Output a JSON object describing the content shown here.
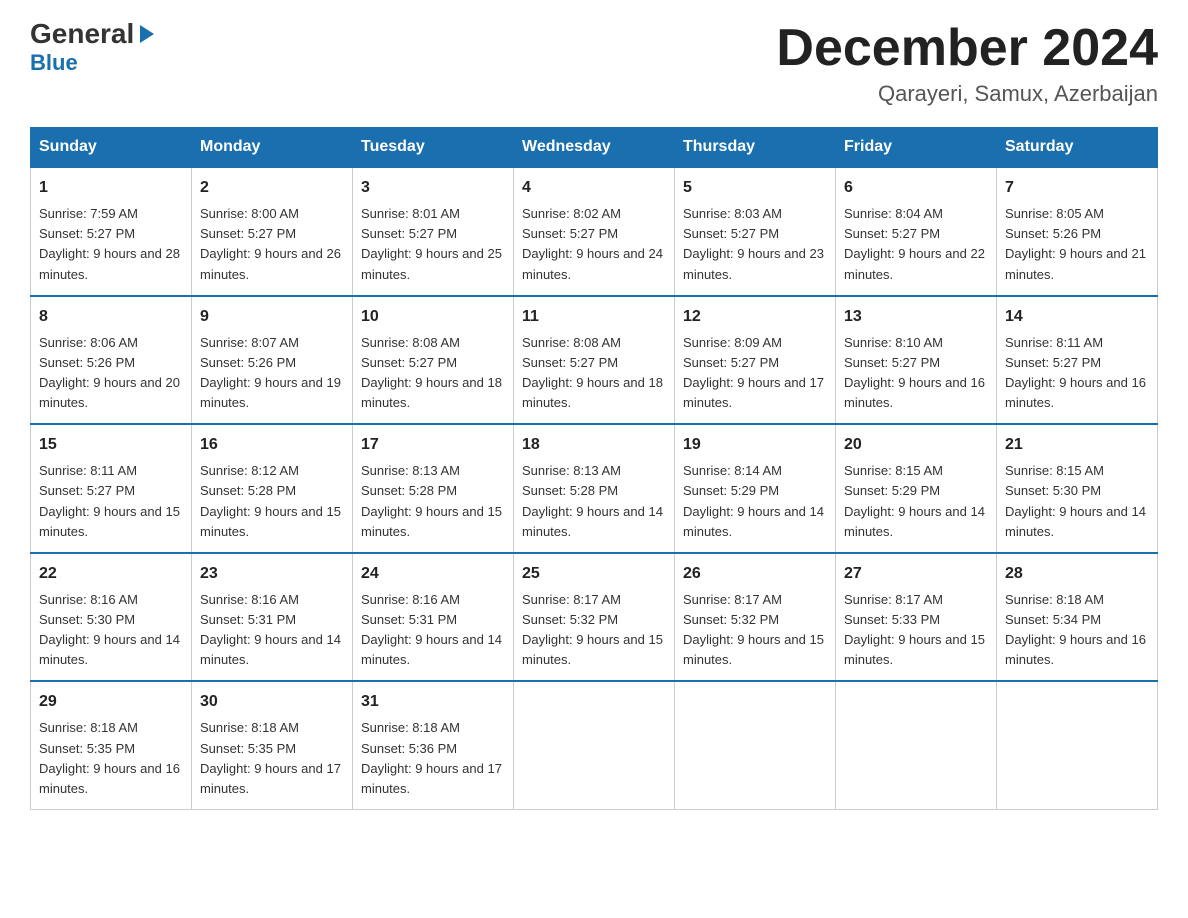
{
  "logo": {
    "line1_black": "General",
    "line1_blue": "Blue",
    "line2": "Blue"
  },
  "header": {
    "month_year": "December 2024",
    "location": "Qarayeri, Samux, Azerbaijan"
  },
  "days_of_week": [
    "Sunday",
    "Monday",
    "Tuesday",
    "Wednesday",
    "Thursday",
    "Friday",
    "Saturday"
  ],
  "weeks": [
    [
      {
        "day": "1",
        "sunrise": "7:59 AM",
        "sunset": "5:27 PM",
        "daylight": "9 hours and 28 minutes."
      },
      {
        "day": "2",
        "sunrise": "8:00 AM",
        "sunset": "5:27 PM",
        "daylight": "9 hours and 26 minutes."
      },
      {
        "day": "3",
        "sunrise": "8:01 AM",
        "sunset": "5:27 PM",
        "daylight": "9 hours and 25 minutes."
      },
      {
        "day": "4",
        "sunrise": "8:02 AM",
        "sunset": "5:27 PM",
        "daylight": "9 hours and 24 minutes."
      },
      {
        "day": "5",
        "sunrise": "8:03 AM",
        "sunset": "5:27 PM",
        "daylight": "9 hours and 23 minutes."
      },
      {
        "day": "6",
        "sunrise": "8:04 AM",
        "sunset": "5:27 PM",
        "daylight": "9 hours and 22 minutes."
      },
      {
        "day": "7",
        "sunrise": "8:05 AM",
        "sunset": "5:26 PM",
        "daylight": "9 hours and 21 minutes."
      }
    ],
    [
      {
        "day": "8",
        "sunrise": "8:06 AM",
        "sunset": "5:26 PM",
        "daylight": "9 hours and 20 minutes."
      },
      {
        "day": "9",
        "sunrise": "8:07 AM",
        "sunset": "5:26 PM",
        "daylight": "9 hours and 19 minutes."
      },
      {
        "day": "10",
        "sunrise": "8:08 AM",
        "sunset": "5:27 PM",
        "daylight": "9 hours and 18 minutes."
      },
      {
        "day": "11",
        "sunrise": "8:08 AM",
        "sunset": "5:27 PM",
        "daylight": "9 hours and 18 minutes."
      },
      {
        "day": "12",
        "sunrise": "8:09 AM",
        "sunset": "5:27 PM",
        "daylight": "9 hours and 17 minutes."
      },
      {
        "day": "13",
        "sunrise": "8:10 AM",
        "sunset": "5:27 PM",
        "daylight": "9 hours and 16 minutes."
      },
      {
        "day": "14",
        "sunrise": "8:11 AM",
        "sunset": "5:27 PM",
        "daylight": "9 hours and 16 minutes."
      }
    ],
    [
      {
        "day": "15",
        "sunrise": "8:11 AM",
        "sunset": "5:27 PM",
        "daylight": "9 hours and 15 minutes."
      },
      {
        "day": "16",
        "sunrise": "8:12 AM",
        "sunset": "5:28 PM",
        "daylight": "9 hours and 15 minutes."
      },
      {
        "day": "17",
        "sunrise": "8:13 AM",
        "sunset": "5:28 PM",
        "daylight": "9 hours and 15 minutes."
      },
      {
        "day": "18",
        "sunrise": "8:13 AM",
        "sunset": "5:28 PM",
        "daylight": "9 hours and 14 minutes."
      },
      {
        "day": "19",
        "sunrise": "8:14 AM",
        "sunset": "5:29 PM",
        "daylight": "9 hours and 14 minutes."
      },
      {
        "day": "20",
        "sunrise": "8:15 AM",
        "sunset": "5:29 PM",
        "daylight": "9 hours and 14 minutes."
      },
      {
        "day": "21",
        "sunrise": "8:15 AM",
        "sunset": "5:30 PM",
        "daylight": "9 hours and 14 minutes."
      }
    ],
    [
      {
        "day": "22",
        "sunrise": "8:16 AM",
        "sunset": "5:30 PM",
        "daylight": "9 hours and 14 minutes."
      },
      {
        "day": "23",
        "sunrise": "8:16 AM",
        "sunset": "5:31 PM",
        "daylight": "9 hours and 14 minutes."
      },
      {
        "day": "24",
        "sunrise": "8:16 AM",
        "sunset": "5:31 PM",
        "daylight": "9 hours and 14 minutes."
      },
      {
        "day": "25",
        "sunrise": "8:17 AM",
        "sunset": "5:32 PM",
        "daylight": "9 hours and 15 minutes."
      },
      {
        "day": "26",
        "sunrise": "8:17 AM",
        "sunset": "5:32 PM",
        "daylight": "9 hours and 15 minutes."
      },
      {
        "day": "27",
        "sunrise": "8:17 AM",
        "sunset": "5:33 PM",
        "daylight": "9 hours and 15 minutes."
      },
      {
        "day": "28",
        "sunrise": "8:18 AM",
        "sunset": "5:34 PM",
        "daylight": "9 hours and 16 minutes."
      }
    ],
    [
      {
        "day": "29",
        "sunrise": "8:18 AM",
        "sunset": "5:35 PM",
        "daylight": "9 hours and 16 minutes."
      },
      {
        "day": "30",
        "sunrise": "8:18 AM",
        "sunset": "5:35 PM",
        "daylight": "9 hours and 17 minutes."
      },
      {
        "day": "31",
        "sunrise": "8:18 AM",
        "sunset": "5:36 PM",
        "daylight": "9 hours and 17 minutes."
      },
      null,
      null,
      null,
      null
    ]
  ]
}
